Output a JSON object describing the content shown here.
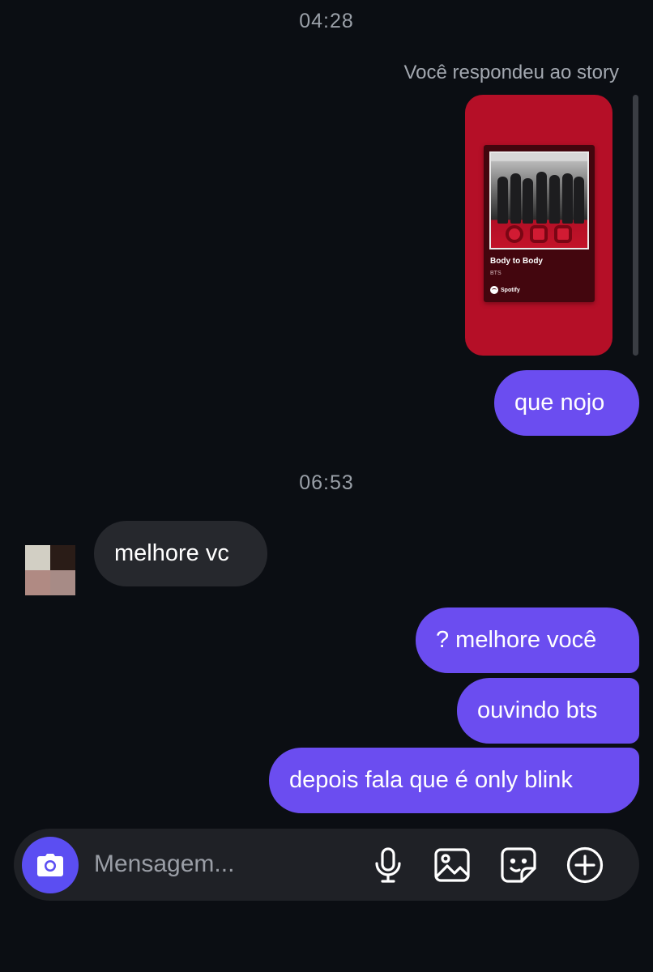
{
  "conversation": {
    "timestamp_1": "04:28",
    "story_reply_note": "Você respondeu ao story",
    "story": {
      "track_title": "Body to Body",
      "track_artist": "BTS",
      "service": "Spotify"
    },
    "timestamp_2": "06:53",
    "messages": [
      {
        "sender": "me",
        "text": "que nojo"
      },
      {
        "sender": "them",
        "text": "melhore vc"
      },
      {
        "sender": "me",
        "text": "? melhore você"
      },
      {
        "sender": "me",
        "text": "ouvindo bts"
      },
      {
        "sender": "me",
        "text": "depois fala que é only blink"
      }
    ]
  },
  "composer": {
    "placeholder": "Mensagem...",
    "icons": [
      "camera-icon",
      "microphone-icon",
      "image-icon",
      "sticker-icon",
      "plus-circle-icon"
    ]
  },
  "colors": {
    "background": "#0b0e13",
    "my_bubble": "#6b4df0",
    "their_bubble": "#26282d",
    "camera_button": "#5b4ef2",
    "story_card": "#b50f27"
  }
}
